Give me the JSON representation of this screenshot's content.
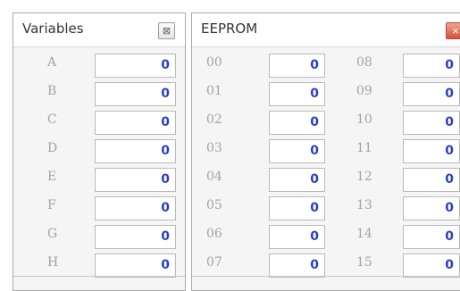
{
  "variables": {
    "title": "Variables",
    "close_icon": "⊠",
    "rows": [
      {
        "label": "A",
        "value": "0"
      },
      {
        "label": "B",
        "value": "0"
      },
      {
        "label": "C",
        "value": "0"
      },
      {
        "label": "D",
        "value": "0"
      },
      {
        "label": "E",
        "value": "0"
      },
      {
        "label": "F",
        "value": "0"
      },
      {
        "label": "G",
        "value": "0"
      },
      {
        "label": "H",
        "value": "0"
      }
    ]
  },
  "eeprom": {
    "title": "EEPROM",
    "close_icon": "×",
    "left_rows": [
      {
        "label": "00",
        "value": "0"
      },
      {
        "label": "01",
        "value": "0"
      },
      {
        "label": "02",
        "value": "0"
      },
      {
        "label": "03",
        "value": "0"
      },
      {
        "label": "04",
        "value": "0"
      },
      {
        "label": "05",
        "value": "0"
      },
      {
        "label": "06",
        "value": "0"
      },
      {
        "label": "07",
        "value": "0"
      }
    ],
    "right_rows": [
      {
        "label": "08",
        "value": "0"
      },
      {
        "label": "09",
        "value": "0"
      },
      {
        "label": "10",
        "value": "0"
      },
      {
        "label": "11",
        "value": "0"
      },
      {
        "label": "12",
        "value": "0"
      },
      {
        "label": "13",
        "value": "0"
      },
      {
        "label": "14",
        "value": "0"
      },
      {
        "label": "15",
        "value": "0"
      }
    ]
  },
  "colors": {
    "value_text": "#2b3fc2",
    "label_text": "#a3a3a3",
    "eeprom_close": "#d4503a"
  }
}
